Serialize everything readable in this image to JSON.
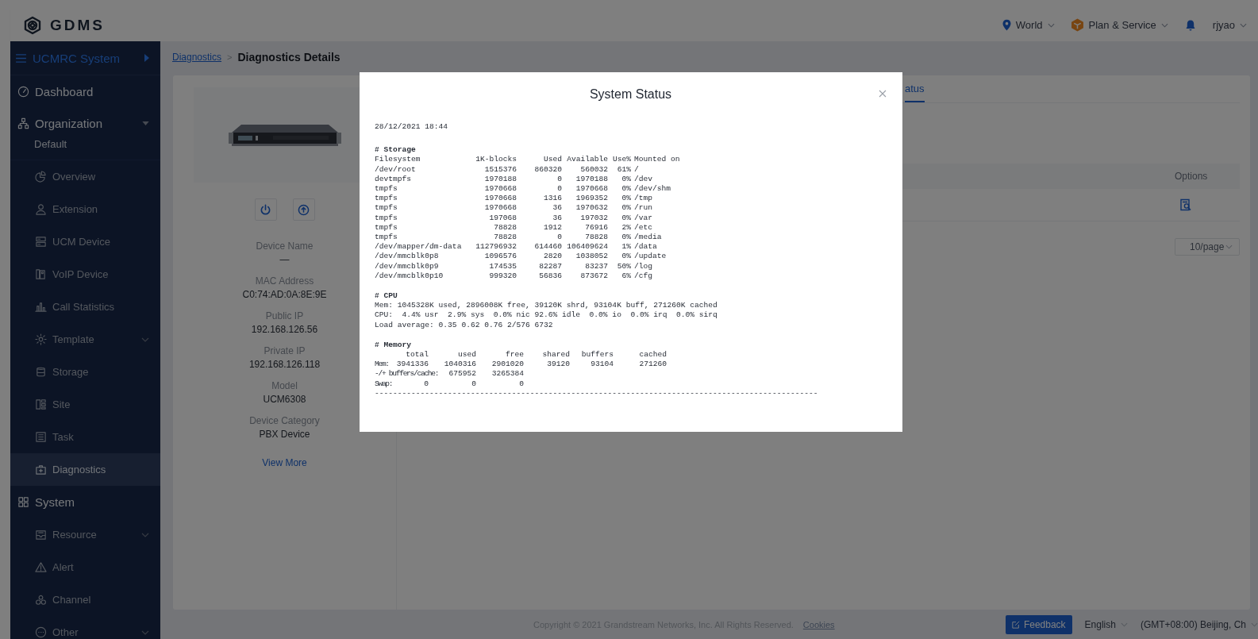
{
  "header": {
    "logo": "GDMS",
    "menus": [
      {
        "label": "World",
        "kind": "region"
      },
      {
        "label": "Plan & Service",
        "kind": "plan"
      },
      {
        "label": "rjyao",
        "kind": "user"
      }
    ]
  },
  "sidebar": {
    "system": "UCMRC System",
    "items": [
      {
        "label": "Dashboard",
        "selected": false
      },
      {
        "label": "Organization",
        "expanded": true,
        "subtitle": "Default",
        "selected": false,
        "children": [
          {
            "label": "Overview",
            "selected": false
          },
          {
            "label": "Extension",
            "selected": false
          },
          {
            "label": "UCM Device",
            "selected": false
          },
          {
            "label": "VoIP Device",
            "selected": false
          },
          {
            "label": "Call Statistics",
            "selected": false
          },
          {
            "label": "Template",
            "expanded": false,
            "selected": false
          },
          {
            "label": "Storage",
            "selected": false
          },
          {
            "label": "Site",
            "selected": false
          },
          {
            "label": "Task",
            "selected": false
          },
          {
            "label": "Diagnostics",
            "selected": true
          }
        ]
      },
      {
        "label": "System",
        "selected": false,
        "children": [
          {
            "label": "Resource",
            "expanded": false,
            "selected": false
          },
          {
            "label": "Alert",
            "selected": false
          },
          {
            "label": "Channel",
            "selected": false
          },
          {
            "label": "Other",
            "expanded": false,
            "selected": false
          }
        ]
      }
    ]
  },
  "breadcrumb": {
    "link": "Diagnostics",
    "separator": ">",
    "current": "Diagnostics Details"
  },
  "device": {
    "fields": [
      {
        "label": "Device Name",
        "value": "—"
      },
      {
        "label": "MAC Address",
        "value": "C0:74:AD:0A:8E:9E"
      },
      {
        "label": "Public IP",
        "value": "192.168.126.56"
      },
      {
        "label": "Private IP",
        "value": "192.168.126.118"
      },
      {
        "label": "Model",
        "value": "UCM6308"
      },
      {
        "label": "Device Category",
        "value": "PBX Device"
      }
    ],
    "link": "View More"
  },
  "tabs": [
    {
      "label": "atus",
      "selected": true
    }
  ],
  "table": {
    "columns": [
      "Options"
    ],
    "rows": [
      {
        "kind": "view"
      }
    ]
  },
  "pagination": {
    "page_size": "10/page"
  },
  "modal": {
    "title": "System Status",
    "timestamp": "28/12/2021 18:44",
    "storage": {
      "heading": "# Storage",
      "columns": [
        "Filesystem",
        "1K-blocks",
        "Used",
        "Available",
        "Use%",
        "Mounted on"
      ],
      "rows": [
        [
          "/dev/root",
          "1515376",
          "860320",
          "560032",
          "61%",
          "/"
        ],
        [
          "devtmpfs",
          "1970188",
          "0",
          "1970188",
          "0%",
          "/dev"
        ],
        [
          "tmpfs",
          "1970668",
          "0",
          "1970668",
          "0%",
          "/dev/shm"
        ],
        [
          "tmpfs",
          "1970668",
          "1316",
          "1969352",
          "0%",
          "/tmp"
        ],
        [
          "tmpfs",
          "1970668",
          "36",
          "1970632",
          "0%",
          "/run"
        ],
        [
          "tmpfs",
          "197068",
          "36",
          "197032",
          "0%",
          "/var"
        ],
        [
          "tmpfs",
          "78828",
          "1912",
          "76916",
          "2%",
          "/etc"
        ],
        [
          "tmpfs",
          "78828",
          "0",
          "78828",
          "0%",
          "/media"
        ],
        [
          "/dev/mapper/dm-data",
          "112796932",
          "614460",
          "106409624",
          "1%",
          "/data"
        ],
        [
          "/dev/mmcblk0p8",
          "1096576",
          "2820",
          "1038052",
          "0%",
          "/update"
        ],
        [
          "/dev/mmcblk0p9",
          "174535",
          "82287",
          "83237",
          "50%",
          "/log"
        ],
        [
          "/dev/mmcblk0p10",
          "999320",
          "56836",
          "873672",
          "6%",
          "/cfg"
        ]
      ]
    },
    "cpu": {
      "heading": "# CPU",
      "lines": [
        "Mem: 1045328K used, 2896008K free, 39120K shrd, 93104K buff, 271260K cached",
        "CPU:  4.4% usr  2.9% sys  0.0% nic 92.6% idle  0.0% io  0.0% irq  0.0% sirq",
        "Load average: 0.35 0.62 0.76 2/576 6732"
      ]
    },
    "memory": {
      "heading": "# Memory",
      "columns": [
        "total",
        "used",
        "free",
        "shared",
        "buffers",
        "cached"
      ],
      "rows": [
        {
          "label": "Mem:",
          "kind": "full",
          "values": [
            "3941336",
            "1040316",
            "2901020",
            "39120",
            "93104",
            "271260"
          ]
        },
        {
          "label": "-/+ buffers/cache:",
          "kind": "subtotal",
          "values": [
            "675952",
            "3265384"
          ]
        },
        {
          "label": "Swap:",
          "kind": "full",
          "values": [
            "0",
            "0",
            "0"
          ]
        }
      ]
    },
    "rule": "-------------------------------------------------------------------------------------------------"
  },
  "footer": {
    "copyright": "Copyright © 2021 Grandstream Networks, Inc. All Rights Reserved.",
    "link": "Cookies",
    "feedback": "Feedback",
    "language": "English",
    "timezone": "(GMT+08:00) Beijing, Ch"
  }
}
